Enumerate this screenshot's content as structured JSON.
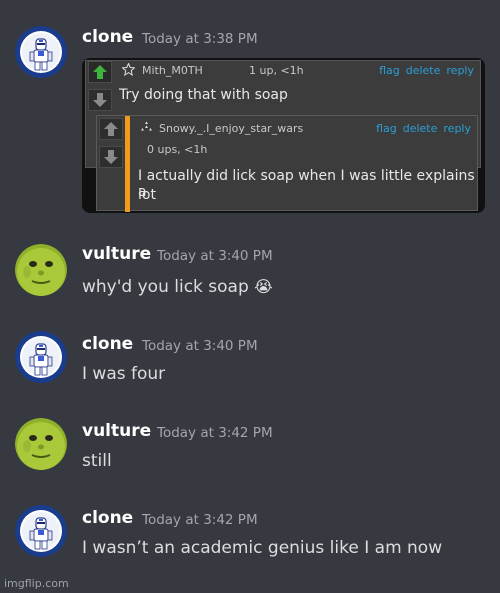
{
  "colors": {
    "background": "#36393f",
    "username": "#ffffff",
    "timestamp": "#a3a6aa",
    "message_text": "#dcddde",
    "link_blue": "#2a9fd6",
    "reply_bar_orange": "#f29a1c",
    "upvote_green": "#3fb33f"
  },
  "messages": [
    {
      "author": "clone",
      "avatar": "clone-trooper-avatar",
      "time": "Today at 3:38 PM",
      "embed": {
        "comment1": {
          "user": "Mith_M0TH",
          "stats": "1 up, <1h",
          "actions": [
            "flag",
            "delete",
            "reply"
          ],
          "text": "Try doing that with soap"
        },
        "comment2": {
          "user": "Snowy._.I_enjoy_star_wars",
          "stats": "0 ups, <1h",
          "actions": [
            "flag",
            "delete",
            "reply"
          ],
          "text_line1": "I actually did lick soap when I was little explains a",
          "text_line2": "lot"
        }
      }
    },
    {
      "author": "vulture",
      "avatar": "green-face-avatar",
      "time": "Today at 3:40 PM",
      "text": "why'd you lick soap",
      "emoji": "😭"
    },
    {
      "author": "clone",
      "avatar": "clone-trooper-avatar",
      "time": "Today at 3:40 PM",
      "text": "I was four"
    },
    {
      "author": "vulture",
      "avatar": "green-face-avatar",
      "time": "Today at 3:42 PM",
      "text": "still"
    },
    {
      "author": "clone",
      "avatar": "clone-trooper-avatar",
      "time": "Today at 3:42 PM",
      "text": "I wasn’t an academic genius like I am now"
    }
  ],
  "watermark": "imgflip.com"
}
